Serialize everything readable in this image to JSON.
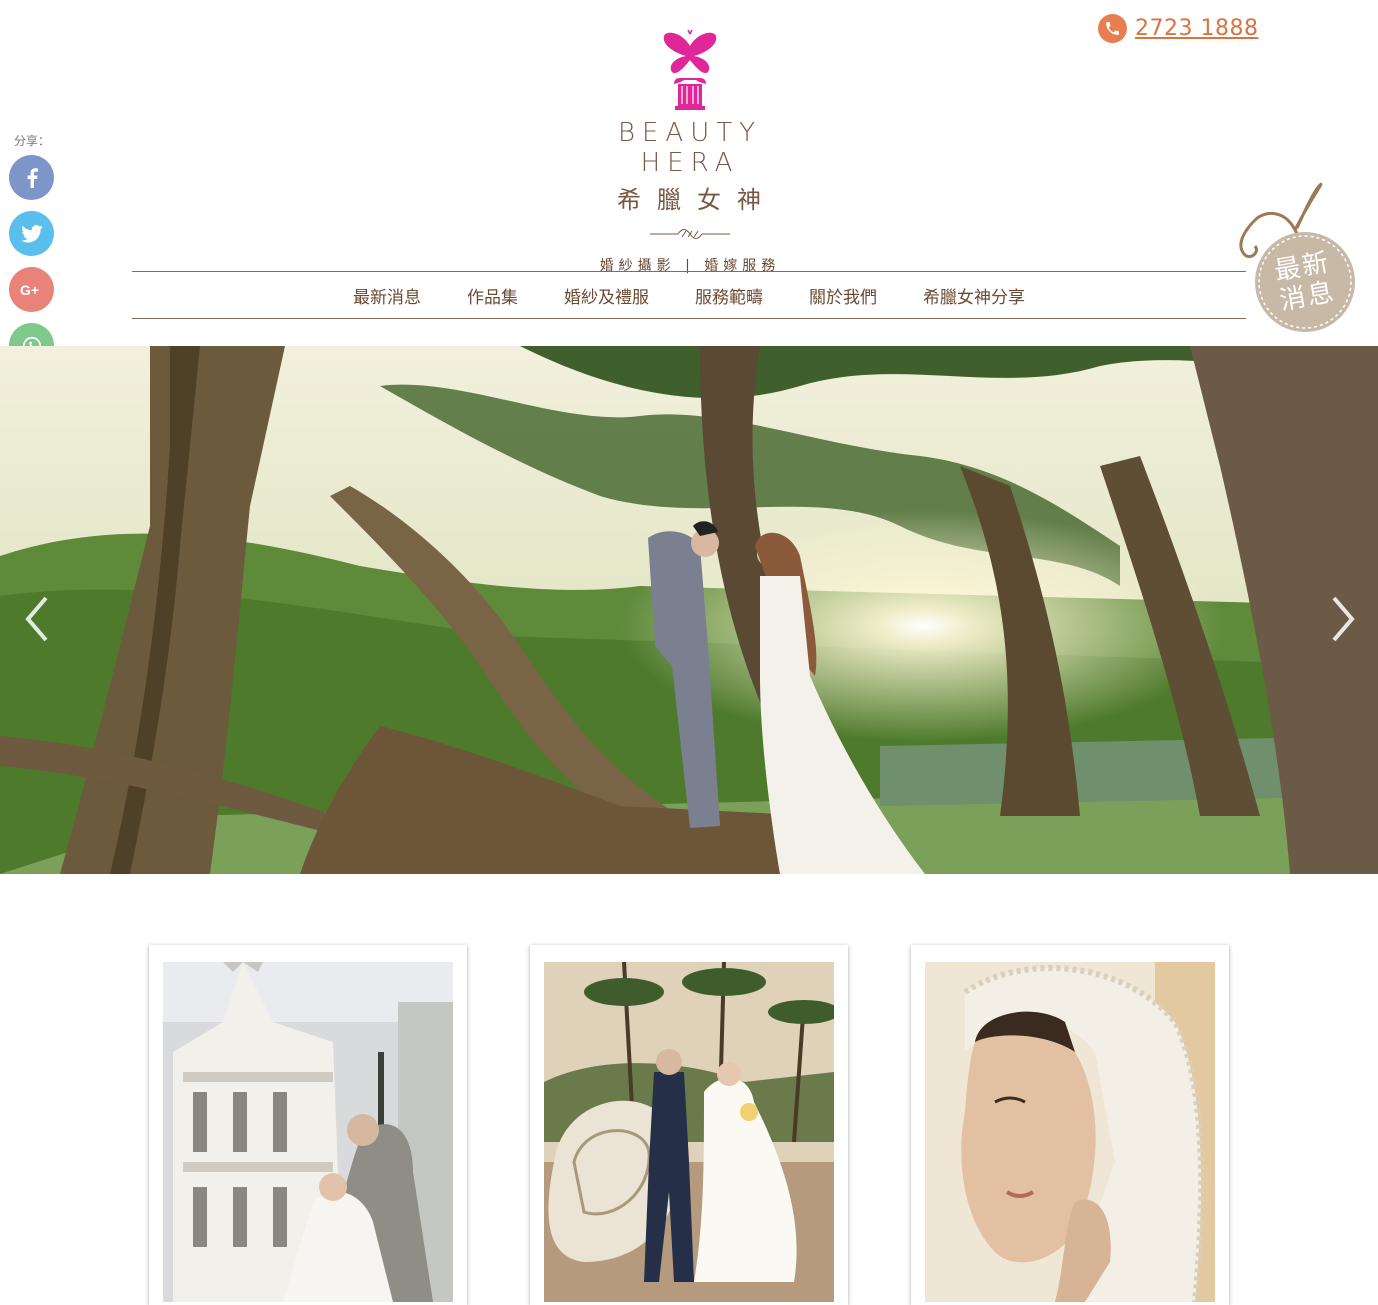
{
  "header": {
    "phone": "2723 1888",
    "brand_en": "BEAUTY HERA",
    "brand_zh": "希臘女神",
    "tagline": "婚紗攝影 | 婚嫁服務"
  },
  "share": {
    "label": "分享：",
    "buttons": [
      "facebook",
      "twitter",
      "google-plus",
      "whatsapp",
      "email"
    ]
  },
  "nav": {
    "items": [
      "最新消息",
      "作品集",
      "婚紗及禮服",
      "服務範疇",
      "關於我們",
      "希臘女神分享"
    ]
  },
  "news_tag": {
    "label": "最新消息"
  },
  "colors": {
    "brand_brown": "#6b4a34",
    "phone_orange": "#d7743f",
    "logo_magenta": "#e0279a",
    "tag_beige": "#c8b9a6"
  },
  "hero": {
    "alt": "婚紗攝影"
  },
  "gallery": [
    {
      "alt": "歐式建築婚紗照"
    },
    {
      "alt": "海螺雕塑婚紗照"
    },
    {
      "alt": "蕾絲頭紗新娘"
    }
  ]
}
